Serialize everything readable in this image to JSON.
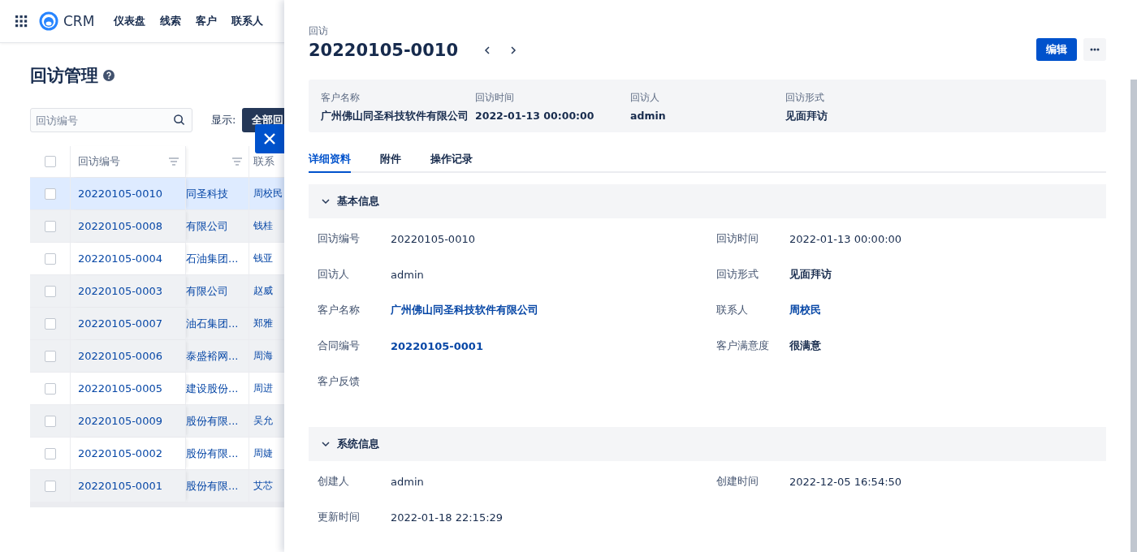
{
  "nav": {
    "brand": "CRM",
    "items": [
      "仪表盘",
      "线索",
      "客户",
      "联系人"
    ]
  },
  "page": {
    "title": "回访管理",
    "search": {
      "placeholder": "回访编号"
    },
    "filter_label": "显示:",
    "filter_button": "全部回"
  },
  "table": {
    "select_all_checked": false,
    "columns": [
      {
        "label": "回访编号",
        "filter": true
      },
      {
        "filter": true
      },
      {
        "label": "联系"
      }
    ],
    "rows": [
      {
        "selected": true,
        "checked": false,
        "cells": [
          "20220105-0010",
          "同圣科技",
          "周校民"
        ]
      },
      {
        "selected": false,
        "shaded": true,
        "checked": false,
        "cells": [
          "20220105-0008",
          "有限公司",
          "钱桂"
        ]
      },
      {
        "selected": false,
        "shaded": false,
        "checked": false,
        "cells": [
          "20220105-0004",
          "石油集团...",
          "钱亚"
        ]
      },
      {
        "selected": false,
        "shaded": true,
        "checked": false,
        "cells": [
          "20220105-0003",
          "有限公司",
          "赵威"
        ]
      },
      {
        "selected": false,
        "shaded": true,
        "checked": false,
        "cells": [
          "20220105-0007",
          "油石集团...",
          "郑雅"
        ]
      },
      {
        "selected": false,
        "shaded": true,
        "checked": false,
        "cells": [
          "20220105-0006",
          "泰盛裕网...",
          "周海"
        ]
      },
      {
        "selected": false,
        "shaded": false,
        "checked": false,
        "cells": [
          "20220105-0005",
          "建设股份...",
          "周进"
        ]
      },
      {
        "selected": false,
        "shaded": true,
        "checked": false,
        "cells": [
          "20220105-0009",
          "股份有限...",
          "吴允"
        ]
      },
      {
        "selected": false,
        "shaded": false,
        "checked": false,
        "cells": [
          "20220105-0002",
          "股份有限...",
          "周婕"
        ]
      },
      {
        "selected": false,
        "shaded": true,
        "checked": false,
        "cells": [
          "20220105-0001",
          "股份有限...",
          "艾芯"
        ]
      }
    ]
  },
  "drawer": {
    "subtitle": "回访",
    "title": "20220105-0010",
    "edit_button": "编辑",
    "summary": [
      {
        "label": "客户名称",
        "value": "广州佛山同圣科技软件有限公司"
      },
      {
        "label": "回访时间",
        "value": "2022-01-13 00:00:00"
      },
      {
        "label": "回访人",
        "value": "admin"
      },
      {
        "label": "回访形式",
        "value": "见面拜访"
      }
    ],
    "tabs": [
      {
        "label": "详细资料",
        "selected": true
      },
      {
        "label": "附件",
        "selected": false
      },
      {
        "label": "操作记录",
        "selected": false
      }
    ],
    "sections": [
      {
        "title": "基本信息",
        "expanded": true,
        "fields": [
          {
            "label": "回访编号",
            "value": "20220105-0010",
            "kind": "text"
          },
          {
            "label": "回访时间",
            "value": "2022-01-13 00:00:00",
            "kind": "text"
          },
          {
            "label": "回访人",
            "value": "admin",
            "kind": "text"
          },
          {
            "label": "回访形式",
            "value": "见面拜访",
            "kind": "strong"
          },
          {
            "label": "客户名称",
            "value": "广州佛山同圣科技软件有限公司",
            "kind": "link"
          },
          {
            "label": "联系人",
            "value": "周校民",
            "kind": "link"
          },
          {
            "label": "合同编号",
            "value": "20220105-0001",
            "kind": "link"
          },
          {
            "label": "客户满意度",
            "value": "很满意",
            "kind": "strong"
          },
          {
            "label": "客户反馈"
          }
        ]
      },
      {
        "title": "系统信息",
        "expanded": true,
        "fields": [
          {
            "label": "创建人",
            "value": "admin",
            "kind": "text"
          },
          {
            "label": "创建时间",
            "value": "2022-12-05 16:54:50",
            "kind": "text"
          },
          {
            "label": "更新时间",
            "value": "2022-01-18 22:15:29",
            "kind": "text"
          }
        ]
      }
    ]
  }
}
